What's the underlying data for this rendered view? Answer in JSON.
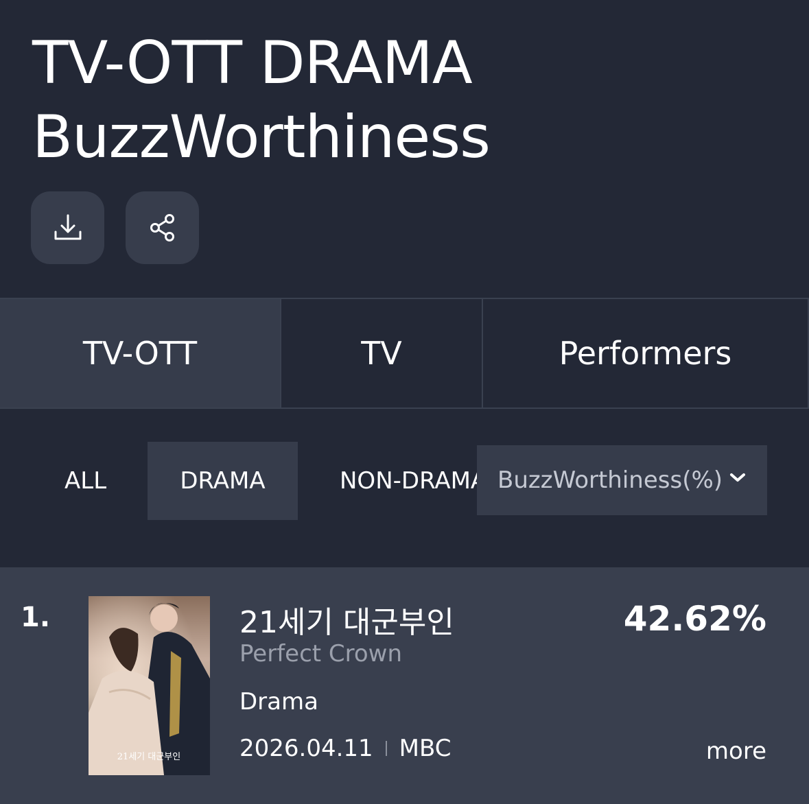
{
  "header": {
    "title_line1": "TV-OTT DRAMA",
    "title_line2": "BuzzWorthiness",
    "actions": [
      {
        "icon": "download-icon"
      },
      {
        "icon": "share-icon"
      }
    ]
  },
  "tabs": [
    {
      "label": "TV-OTT",
      "active": true
    },
    {
      "label": "TV",
      "active": false
    },
    {
      "label": "Performers",
      "active": false
    }
  ],
  "filters": [
    {
      "label": "ALL",
      "active": false
    },
    {
      "label": "DRAMA",
      "active": true
    },
    {
      "label": "NON-DRAMA",
      "active": false
    }
  ],
  "metric_select": {
    "value": "BuzzWorthiness(%)",
    "icon": "chevron-down-icon"
  },
  "ranking": [
    {
      "rank": "1.",
      "title_ko": "21세기 대군부인",
      "title_en": "Perfect Crown",
      "genre": "Drama",
      "date": "2026.04.11",
      "channel": "MBC",
      "percent": "42.62%",
      "more_label": "more",
      "poster_text": "21세기 대군부인"
    }
  ],
  "colors": {
    "background": "#232836",
    "panel": "#363c4b",
    "row": "#393f4e",
    "muted_text": "#9ba0ac"
  }
}
